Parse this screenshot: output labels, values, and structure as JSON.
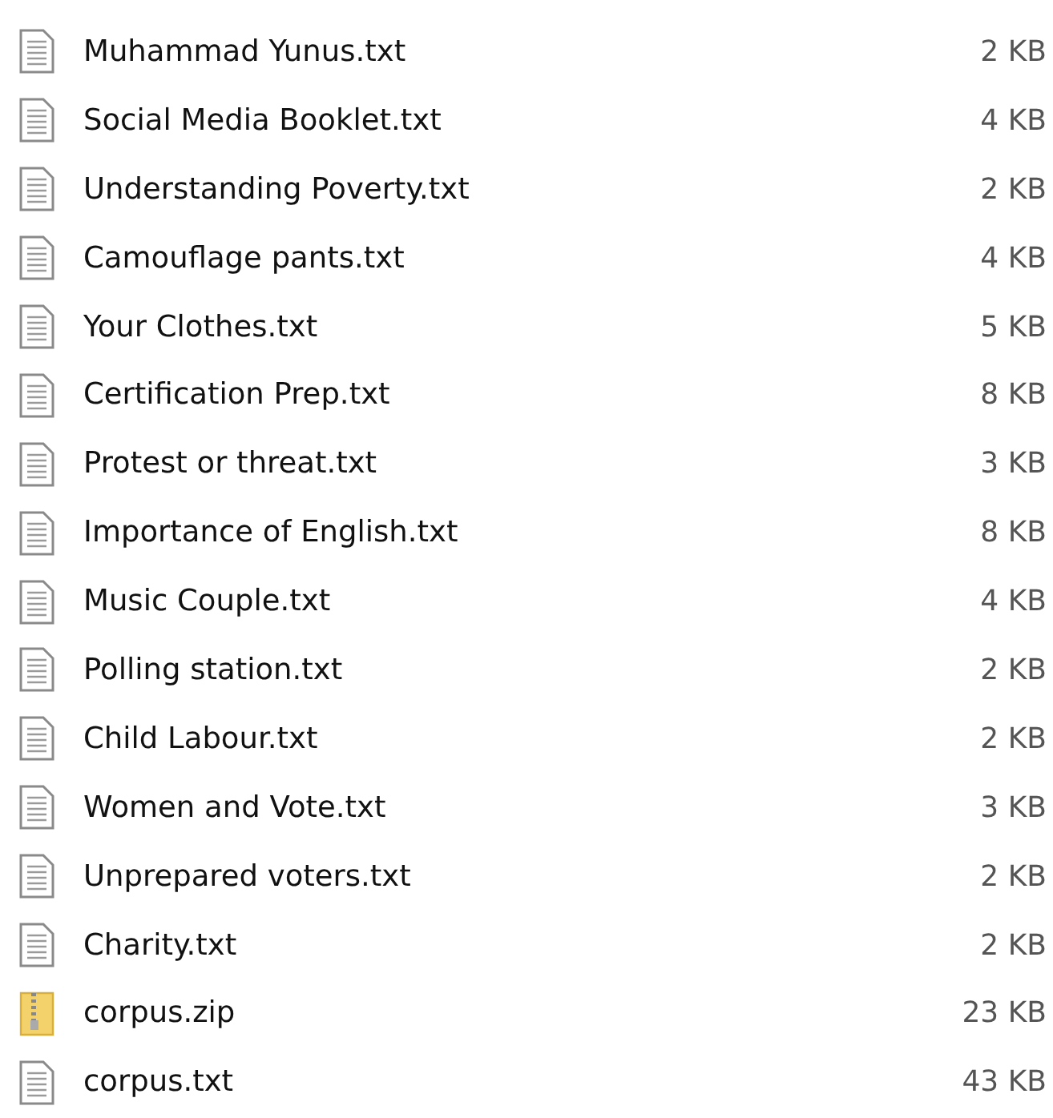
{
  "files": [
    {
      "name": "Muhammad Yunus.txt",
      "size": "2 KB",
      "kind": "text"
    },
    {
      "name": "Social Media Booklet.txt",
      "size": "4 KB",
      "kind": "text"
    },
    {
      "name": "Understanding Poverty.txt",
      "size": "2 KB",
      "kind": "text"
    },
    {
      "name": "Camouflage pants.txt",
      "size": "4 KB",
      "kind": "text"
    },
    {
      "name": "Your Clothes.txt",
      "size": "5 KB",
      "kind": "text"
    },
    {
      "name": "Certification Prep.txt",
      "size": "8 KB",
      "kind": "text"
    },
    {
      "name": "Protest or threat.txt",
      "size": "3 KB",
      "kind": "text"
    },
    {
      "name": "Importance of English.txt",
      "size": "8 KB",
      "kind": "text"
    },
    {
      "name": "Music Couple.txt",
      "size": "4 KB",
      "kind": "text"
    },
    {
      "name": "Polling station.txt",
      "size": "2 KB",
      "kind": "text"
    },
    {
      "name": "Child Labour.txt",
      "size": "2 KB",
      "kind": "text"
    },
    {
      "name": "Women and Vote.txt",
      "size": "3 KB",
      "kind": "text"
    },
    {
      "name": "Unprepared voters.txt",
      "size": "2 KB",
      "kind": "text"
    },
    {
      "name": "Charity.txt",
      "size": "2 KB",
      "kind": "text"
    },
    {
      "name": "corpus.zip",
      "size": "23 KB",
      "kind": "zip"
    },
    {
      "name": "corpus.txt",
      "size": "43 KB",
      "kind": "text"
    }
  ]
}
